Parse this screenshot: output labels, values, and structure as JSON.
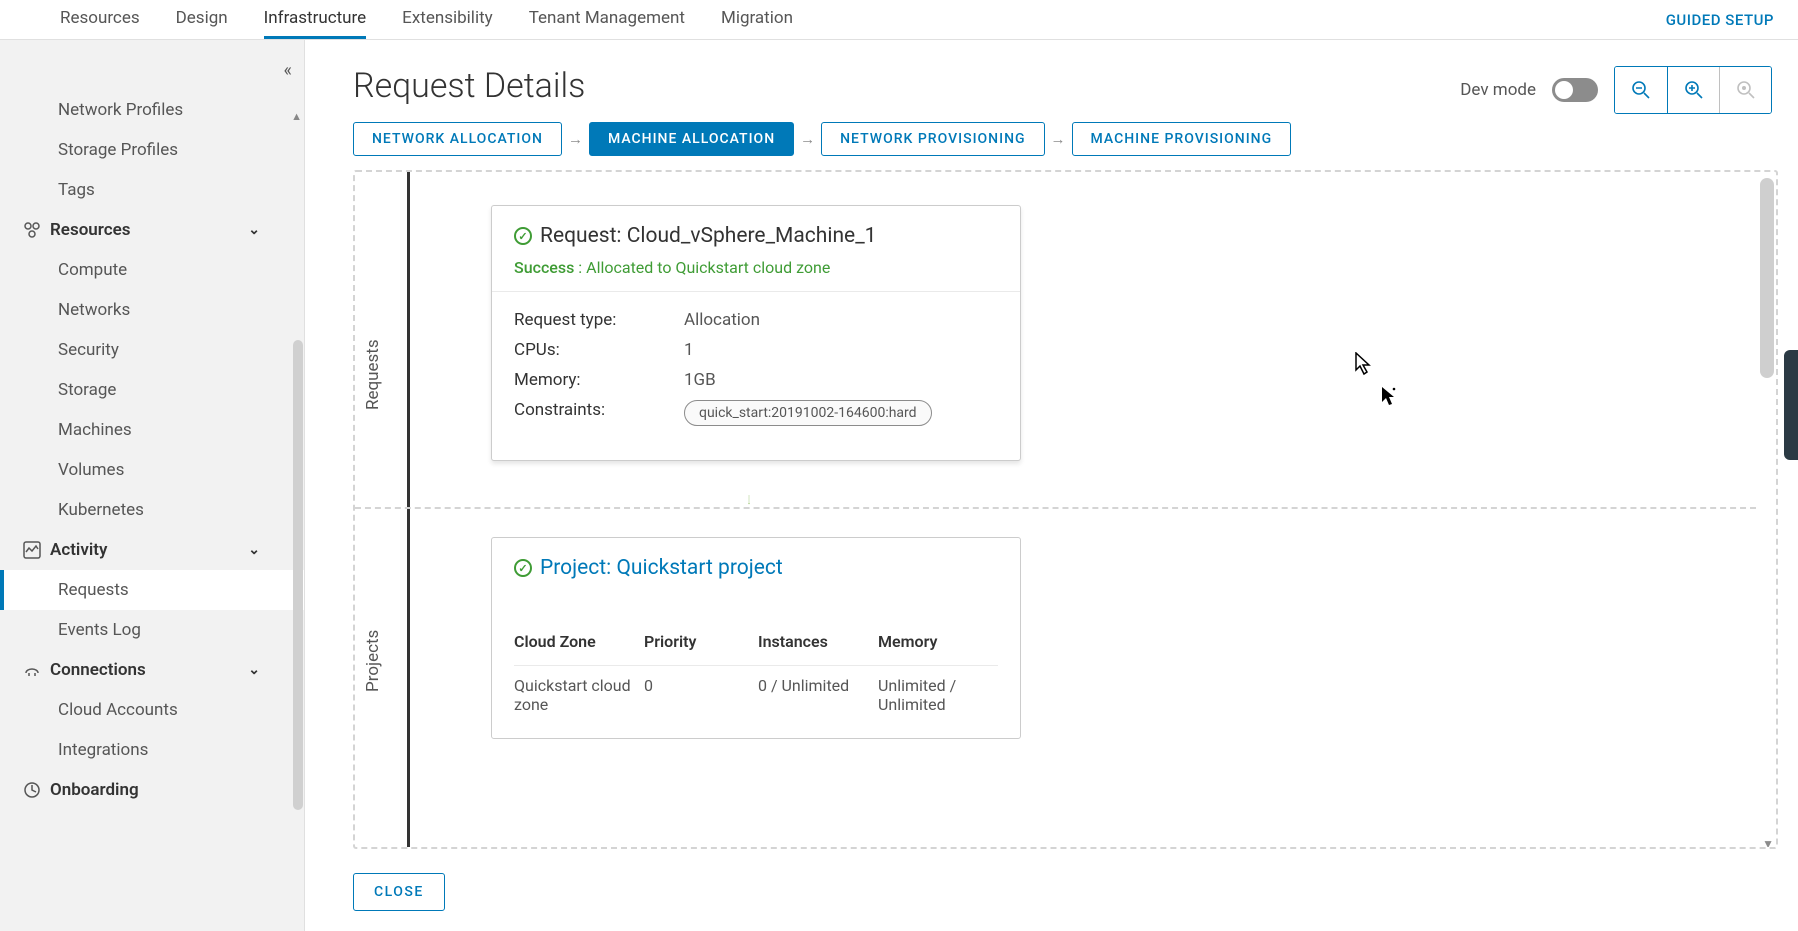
{
  "nav": {
    "items": [
      "Resources",
      "Design",
      "Infrastructure",
      "Extensibility",
      "Tenant Management",
      "Migration"
    ],
    "active_index": 2,
    "guided_setup": "GUIDED SETUP"
  },
  "sidebar": {
    "items": [
      {
        "type": "item",
        "label": "Network Profiles"
      },
      {
        "type": "item",
        "label": "Storage Profiles"
      },
      {
        "type": "item",
        "label": "Tags"
      },
      {
        "type": "group",
        "label": "Resources",
        "icon": "resources-icon"
      },
      {
        "type": "item",
        "label": "Compute"
      },
      {
        "type": "item",
        "label": "Networks"
      },
      {
        "type": "item",
        "label": "Security"
      },
      {
        "type": "item",
        "label": "Storage"
      },
      {
        "type": "item",
        "label": "Machines"
      },
      {
        "type": "item",
        "label": "Volumes"
      },
      {
        "type": "item",
        "label": "Kubernetes"
      },
      {
        "type": "group",
        "label": "Activity",
        "icon": "activity-icon"
      },
      {
        "type": "item",
        "label": "Requests",
        "active": true
      },
      {
        "type": "item",
        "label": "Events Log"
      },
      {
        "type": "group",
        "label": "Connections",
        "icon": "connections-icon"
      },
      {
        "type": "item",
        "label": "Cloud Accounts"
      },
      {
        "type": "item",
        "label": "Integrations"
      },
      {
        "type": "group",
        "label": "Onboarding",
        "icon": "onboarding-icon"
      }
    ]
  },
  "page": {
    "title": "Request Details",
    "dev_mode_label": "Dev mode",
    "close": "CLOSE"
  },
  "steps": [
    "NETWORK ALLOCATION",
    "MACHINE ALLOCATION",
    "NETWORK PROVISIONING",
    "MACHINE PROVISIONING"
  ],
  "steps_active_index": 1,
  "sections": {
    "requests_label": "Requests",
    "projects_label": "Projects"
  },
  "request_card": {
    "title": "Request: Cloud_vSphere_Machine_1",
    "status_strong": "Success",
    "status_rest": " : Allocated to Quickstart cloud zone",
    "rows": {
      "type_label": "Request type:",
      "type_value": "Allocation",
      "cpus_label": "CPUs:",
      "cpus_value": "1",
      "memory_label": "Memory:",
      "memory_value": "1GB",
      "constraints_label": "Constraints:",
      "constraints_value": "quick_start:20191002-164600:hard"
    }
  },
  "project_card": {
    "title": "Project: Quickstart project",
    "columns": [
      "Cloud Zone",
      "Priority",
      "Instances",
      "Memory"
    ],
    "row": {
      "zone": "Quickstart cloud zone",
      "priority": "0",
      "instances": "0 / Unlimited",
      "memory": "Unlimited / Unlimited"
    }
  }
}
